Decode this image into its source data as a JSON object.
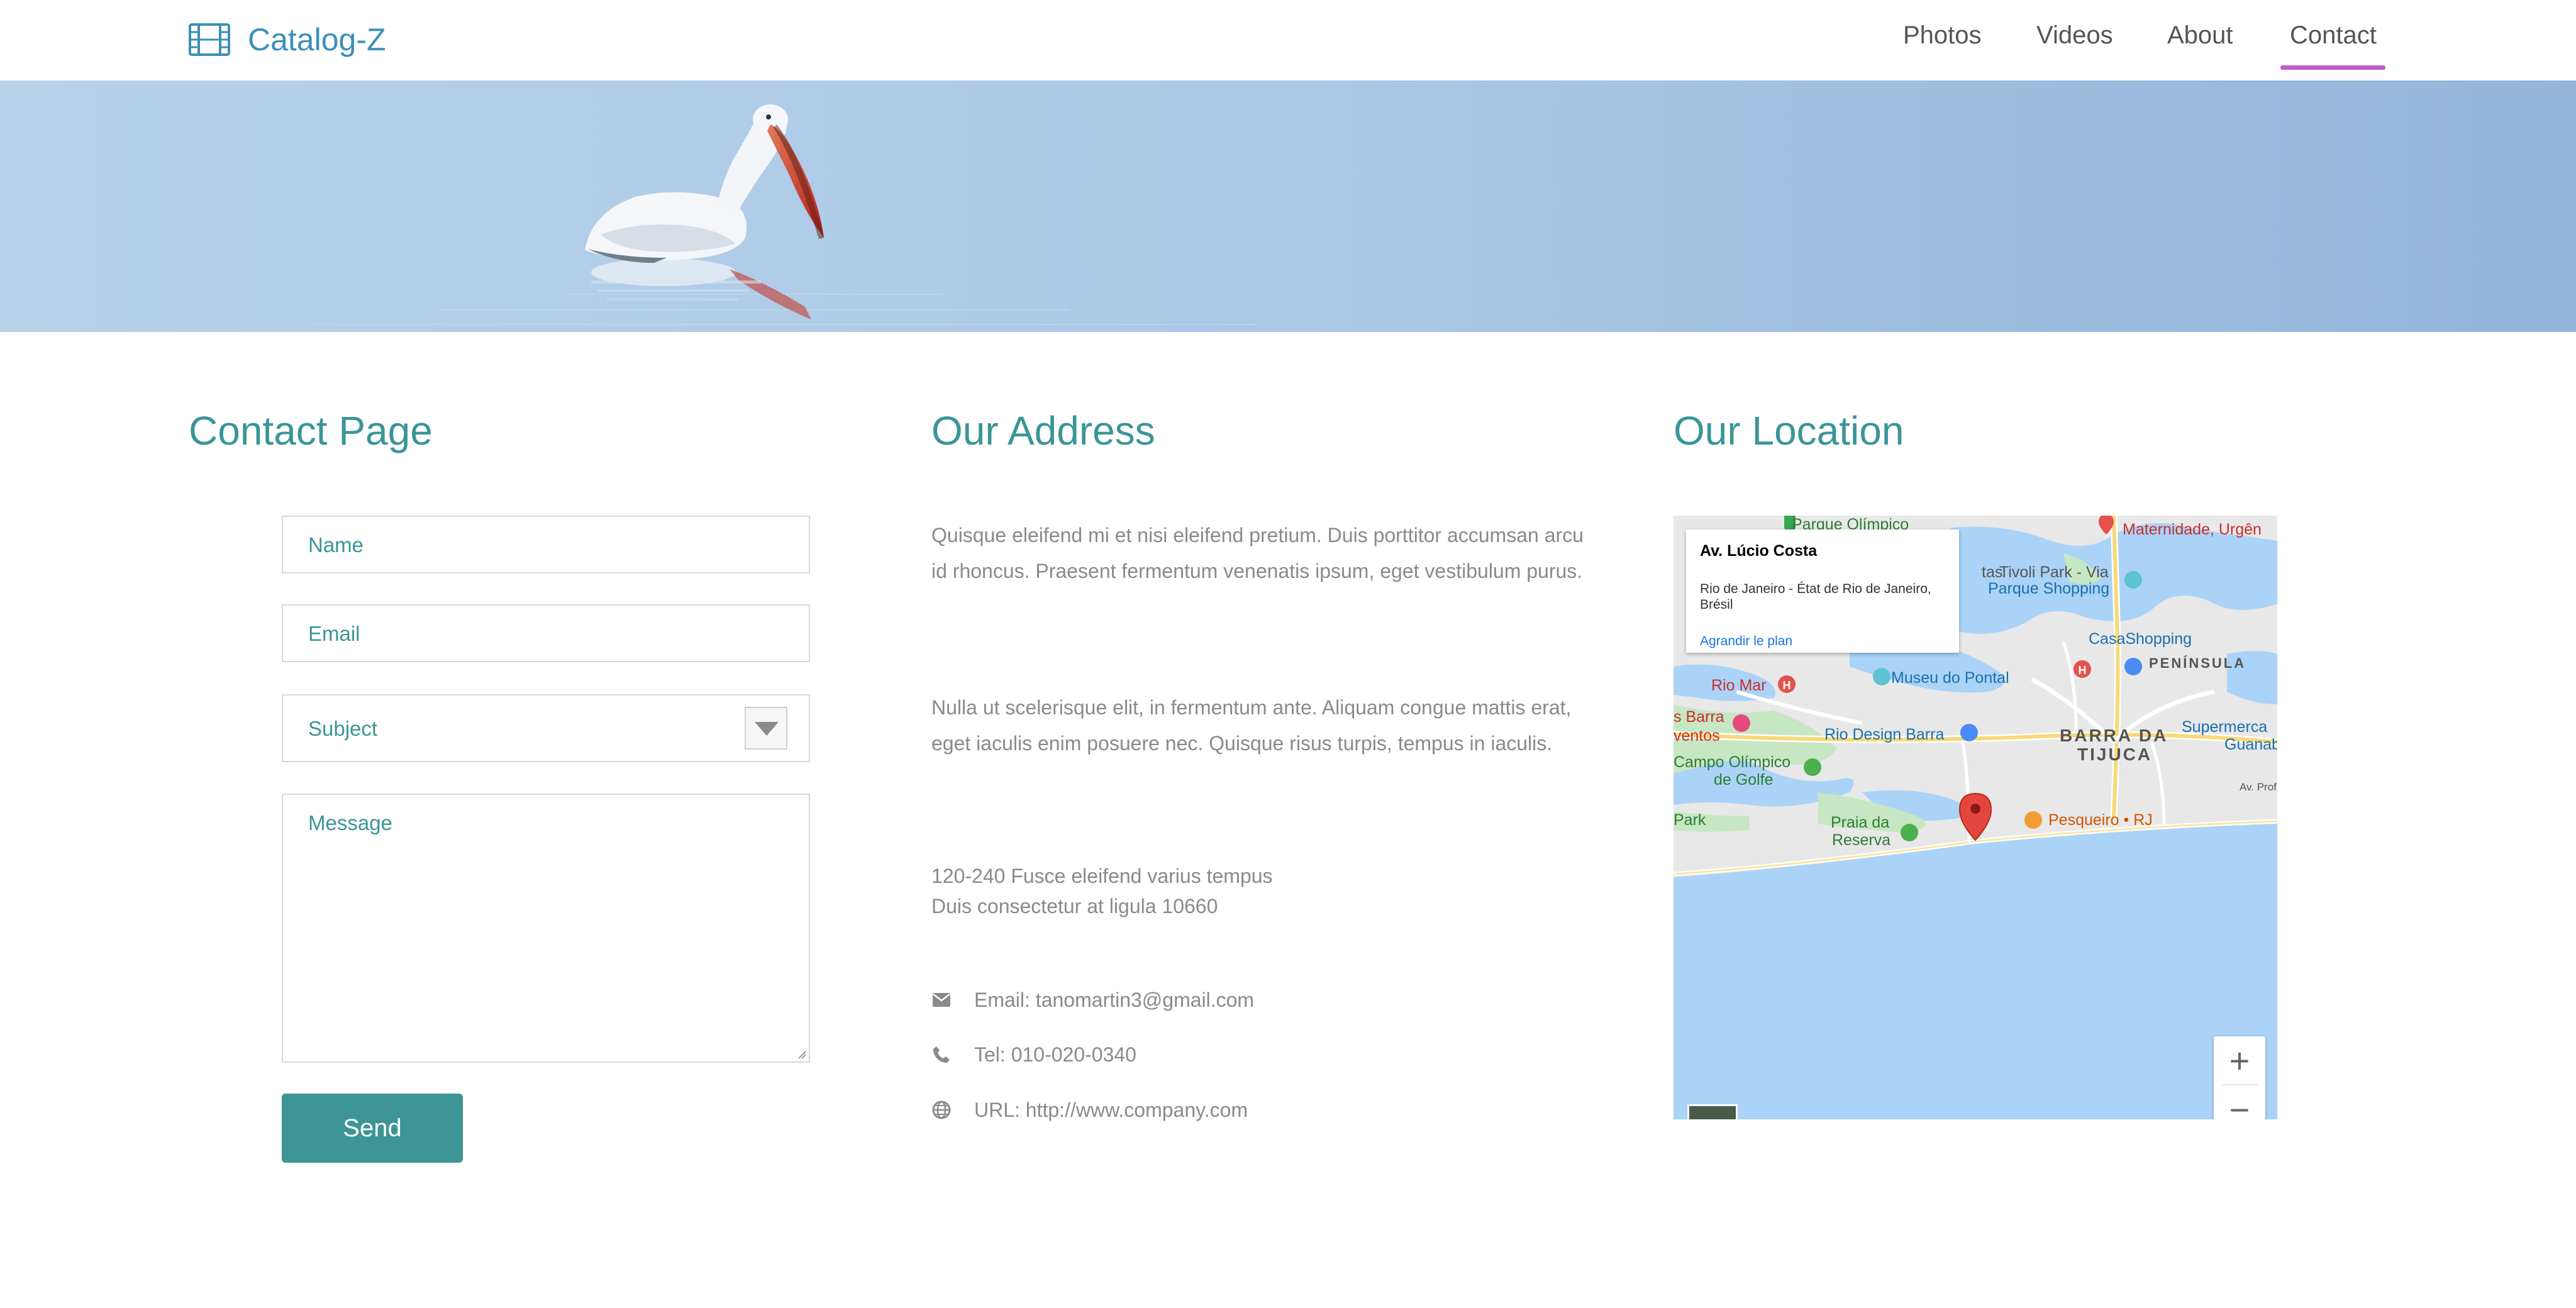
{
  "navbar": {
    "brand": "Catalog-Z",
    "links": [
      {
        "label": "Photos",
        "active": false
      },
      {
        "label": "Videos",
        "active": false
      },
      {
        "label": "About",
        "active": false
      },
      {
        "label": "Contact",
        "active": true
      }
    ],
    "active_color": "#c35bca",
    "brand_color": "#3d8fb8"
  },
  "contact": {
    "heading": "Contact Page",
    "form": {
      "name_placeholder": "Name",
      "email_placeholder": "Email",
      "subject_placeholder": "Subject",
      "message_placeholder": "Message",
      "send_label": "Send"
    },
    "accent_color": "#3b9596"
  },
  "address": {
    "heading": "Our Address",
    "paragraph1": "Quisque eleifend mi et nisi eleifend pretium. Duis porttitor accumsan arcu id rhoncus. Praesent fermentum venenatis ipsum, eget vestibulum purus.",
    "paragraph2": "Nulla ut scelerisque elit, in fermentum ante. Aliquam congue mattis erat, eget iaculis enim posuere nec. Quisque risus turpis, tempus in iaculis.",
    "line1": "120-240 Fusce eleifend varius tempus",
    "line2": "Duis consectetur at ligula 10660",
    "email": "Email: tanomartin3@gmail.com",
    "tel": "Tel: 010-020-0340",
    "url": "URL: http://www.company.com",
    "icons": [
      "envelope-icon",
      "phone-icon",
      "globe-icon"
    ]
  },
  "location": {
    "heading": "Our Location",
    "map": {
      "card_title": "Av. Lúcio Costa",
      "card_subtitle": "Rio de Janeiro - État de Rio de Janeiro, Brésil",
      "card_link": "Agrandir le plan",
      "labels": {
        "parque_olimpico": "Parque Olímpico",
        "maternidade": "Maternidade, Urgên",
        "tas": "tas",
        "tivoli": "Tivoli Park - Via",
        "parque_shopping": "Parque Shopping",
        "casashopping": "CasaShopping",
        "peninsula": "PENÍNSULA",
        "museu": "Museu do Pontal",
        "rio_mar": "Rio Mar",
        "s_barra": "s Barra",
        "ventos": "ventos",
        "rio_design": "Rio Design Barra",
        "barra_da": "BARRA DA",
        "tijuca": "TIJUCA",
        "supermerca": "Supermerca",
        "guanab": "Guanab",
        "av_prof": "Av. Prof. D",
        "campo": "Campo Olímpico",
        "de_golfe": "de Golfe",
        "park": "Park",
        "praia_da": "Praia da",
        "reserva": "Reserva",
        "pesqueiro": "Pesqueiro • RJ"
      },
      "zoom_in": "+",
      "zoom_out": "−",
      "water_color": "#aad3f7",
      "land_color": "#e8e8e8",
      "park_color": "#c7e6c3"
    }
  }
}
